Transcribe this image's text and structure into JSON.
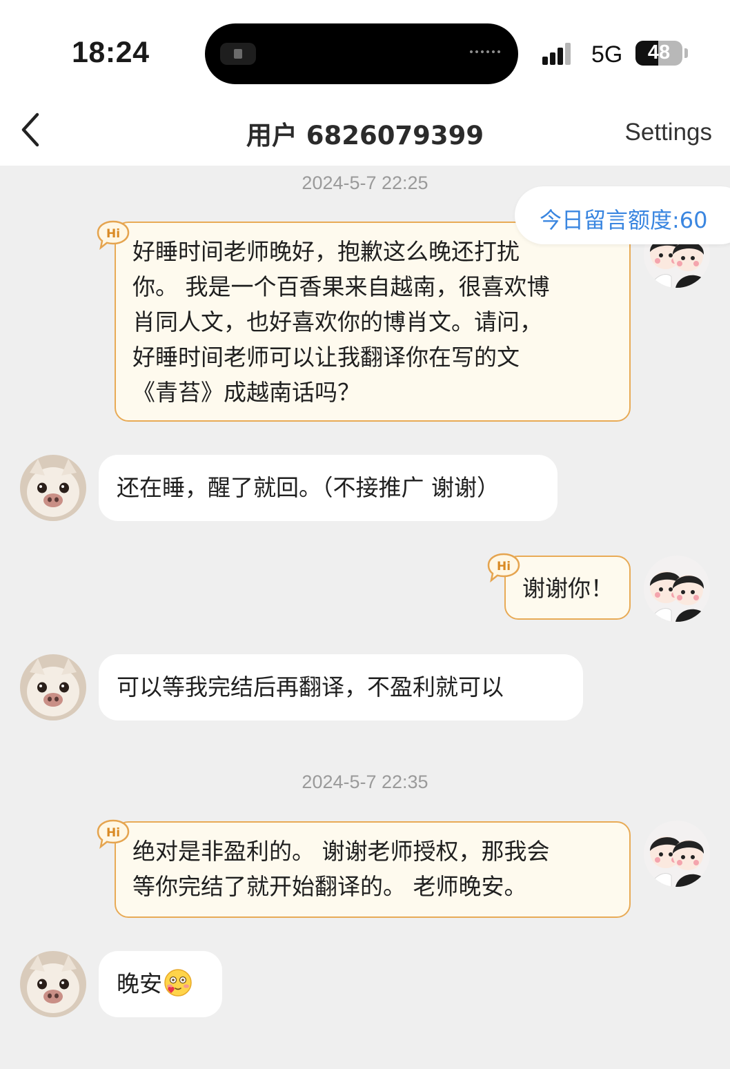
{
  "status_bar": {
    "time": "18:24",
    "network": "5G",
    "battery": "48",
    "battery_level": 0.48
  },
  "nav": {
    "back_icon": "chevron-left-icon",
    "title": "用户 6826079399",
    "settings": "Settings"
  },
  "quota": {
    "label": "今日留言额度:60"
  },
  "messages": [
    {
      "type": "timestamp",
      "text": "2024-5-7 22:25"
    },
    {
      "type": "outgoing",
      "badge": "Hi",
      "text": "好睡时间老师晚好，抱歉这么晚还打扰\n你。 我是一个百香果来自越南，很喜欢博\n肖同人文，也好喜欢你的博肖文。请问，\n好睡时间老师可以让我翻译你在写的文\n《青苔》成越南话吗？"
    },
    {
      "type": "incoming",
      "text": "还在睡，醒了就回。（不接推广 谢谢）"
    },
    {
      "type": "outgoing",
      "badge": "Hi",
      "text": "谢谢你！"
    },
    {
      "type": "incoming",
      "text": "可以等我完结后再翻译，不盈利就可以"
    },
    {
      "type": "timestamp",
      "text": "2024-5-7 22:35"
    },
    {
      "type": "outgoing",
      "badge": "Hi",
      "text": "绝对是非盈利的。 谢谢老师授权，那我会\n等你完结了就开始翻译的。 老师晚安。"
    },
    {
      "type": "incoming",
      "text": "晚安",
      "emoji": "blushing-face-with-heart"
    }
  ],
  "colors": {
    "chat_background": "#efefef",
    "outgoing_bubble": "#fefaee",
    "outgoing_border": "#e8aa55",
    "accent_blue": "#3a86e0"
  }
}
